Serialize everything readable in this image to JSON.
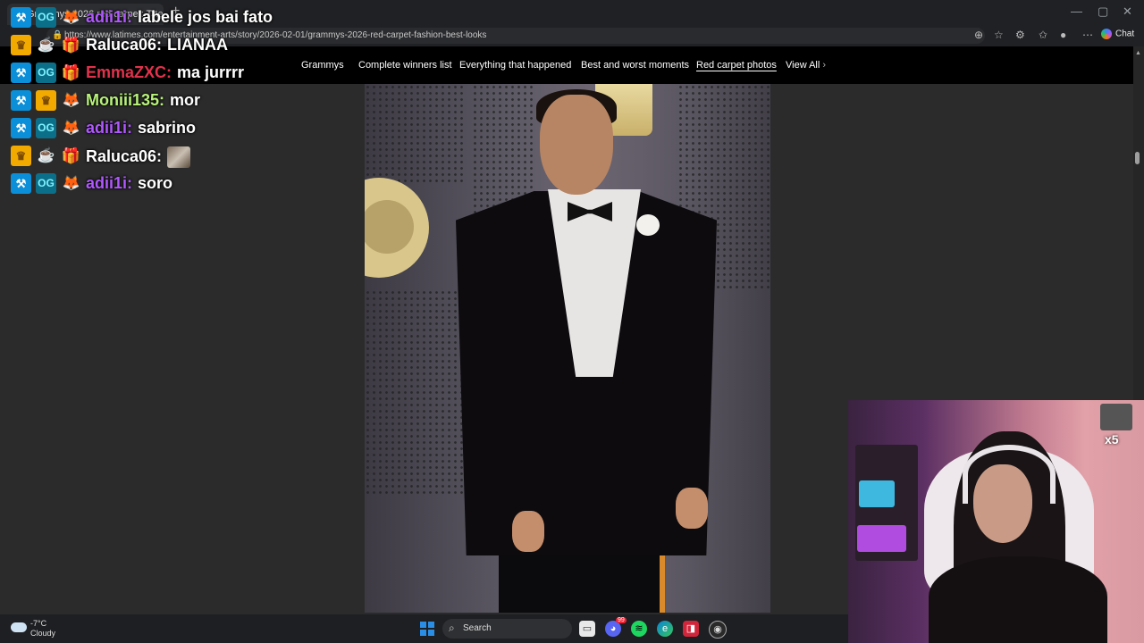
{
  "browser": {
    "tab_title": "Grammys 2026 red carpet: The b",
    "tab_close": "✕",
    "new_tab": "+",
    "url": "https://www.latimes.com/entertainment-arts/story/2026-02-01/grammys-2026-red-carpet-fashion-best-looks",
    "chat_label": "Chat",
    "window_controls": [
      "—",
      "▢",
      "✕"
    ],
    "toolbar_icons": [
      "reader-icon",
      "star-icon",
      "extensions-icon",
      "favorites-icon",
      "profile-icon",
      "more-icon"
    ]
  },
  "site_nav": {
    "links": [
      {
        "label": "Grammys",
        "active": false
      },
      {
        "label": "Complete winners list",
        "active": false
      },
      {
        "label": "Everything that happened",
        "active": false
      },
      {
        "label": "Best and worst moments",
        "active": false
      },
      {
        "label": "Red carpet photos",
        "active": true
      }
    ],
    "view_all": "View All",
    "view_all_chevron": "›"
  },
  "chat": {
    "messages": [
      {
        "user": "adii1i:",
        "color": "#b058ff",
        "text": "labele jos bai fato",
        "badges": [
          "mod",
          "og",
          "fox"
        ]
      },
      {
        "user": "Raluca06:",
        "color": "#ffffff",
        "text": "LIANAA",
        "badges": [
          "crown",
          "cup",
          "gift"
        ]
      },
      {
        "user": "EmmaZXC:",
        "color": "#e0324b",
        "text": "ma jurrrr",
        "badges": [
          "mod",
          "og",
          "gift"
        ]
      },
      {
        "user": "Moniii135:",
        "color": "#b8f27a",
        "text": "mor",
        "badges": [
          "mod",
          "crown",
          "fox"
        ]
      },
      {
        "user": "adii1i:",
        "color": "#b058ff",
        "text": "sabrino",
        "badges": [
          "mod",
          "og",
          "fox"
        ]
      },
      {
        "user": "Raluca06:",
        "color": "#ffffff",
        "text": "",
        "emote": "emote-image",
        "badges": [
          "crown",
          "cup",
          "gift"
        ]
      },
      {
        "user": "adii1i:",
        "color": "#b058ff",
        "text": "soro",
        "badges": [
          "mod",
          "og",
          "fox"
        ]
      }
    ]
  },
  "webcam": {
    "emote_multiplier": "x5"
  },
  "taskbar": {
    "weather_temp": "-7°C",
    "weather_condition": "Cloudy",
    "search_placeholder": "Search",
    "apps": [
      "file-explorer-icon",
      "discord-icon",
      "spotify-icon",
      "edge-icon",
      "app-red-icon",
      "obs-icon"
    ],
    "discord_badge": "99"
  },
  "colors": {
    "nav_background": "#000000",
    "page_background": "#2b2b2b",
    "mod_badge": "#0a8fd8"
  }
}
